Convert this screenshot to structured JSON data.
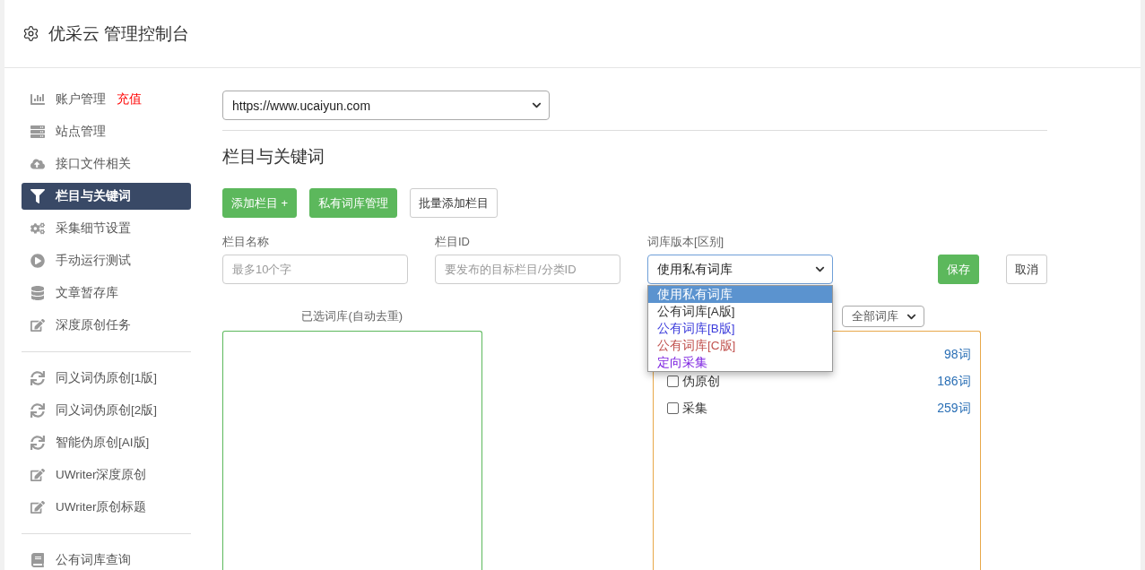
{
  "header": {
    "title": "优采云 管理控制台"
  },
  "sidebar": {
    "groups": [
      {
        "items": [
          {
            "kind": "chart",
            "label": "账户管理",
            "badge": "充值",
            "selected": false
          },
          {
            "kind": "server",
            "label": "站点管理",
            "selected": false
          },
          {
            "kind": "cloud",
            "label": "接口文件相关",
            "selected": false
          },
          {
            "kind": "filter",
            "label": "栏目与关键词",
            "selected": true
          },
          {
            "kind": "cogs",
            "label": "采集细节设置",
            "selected": false
          },
          {
            "kind": "play",
            "label": "手动运行测试",
            "selected": false
          },
          {
            "kind": "database",
            "label": "文章暂存库",
            "selected": false
          },
          {
            "kind": "edit",
            "label": "深度原创任务",
            "selected": false
          }
        ]
      },
      {
        "items": [
          {
            "kind": "sync",
            "label": "同义词伪原创[1版]",
            "selected": false
          },
          {
            "kind": "sync",
            "label": "同义词伪原创[2版]",
            "selected": false
          },
          {
            "kind": "sync",
            "label": "智能伪原创[AI版]",
            "selected": false
          },
          {
            "kind": "edit",
            "label": "UWriter深度原创",
            "selected": false
          },
          {
            "kind": "edit",
            "label": "UWriter原创标题",
            "selected": false
          }
        ]
      },
      {
        "items": [
          {
            "kind": "book",
            "label": "公有词库查询",
            "selected": false
          }
        ]
      }
    ]
  },
  "site_select": {
    "value": "https://www.ucaiyun.com"
  },
  "section_title": "栏目与关键词",
  "actions": [
    {
      "label": "添加栏目 +",
      "kind": "primary"
    },
    {
      "label": "私有词库管理",
      "kind": "primary"
    },
    {
      "label": "批量添加栏目",
      "kind": "default"
    }
  ],
  "form": {
    "name_field": {
      "label": "栏目名称",
      "placeholder": "最多10个字"
    },
    "id_field": {
      "label": "栏目ID",
      "placeholder": "要发布的目标栏目/分类ID"
    },
    "version_select": {
      "label": "词库版本[区别]",
      "value": "使用私有词库",
      "expanded": true,
      "options": [
        {
          "label": "使用私有词库",
          "selected": true
        },
        {
          "label": "公有词库[A版]",
          "selected": false,
          "color": "#333333"
        },
        {
          "label": "公有词库[B版]",
          "selected": false,
          "color": "#3b3bdb"
        },
        {
          "label": "公有词库[C版]",
          "selected": false,
          "color": "#c0504d"
        },
        {
          "label": "定向采集",
          "selected": false,
          "color": "#7b1fe0"
        }
      ]
    },
    "save": "保存",
    "cancel": "取消"
  },
  "selected_library": {
    "title": "已选词库(自动去重)"
  },
  "library_filter": {
    "value": "全部词库"
  },
  "libraries": [
    {
      "count": "98词"
    },
    {
      "name": "伪原创",
      "count": "186词",
      "checked": false
    },
    {
      "name": "采集",
      "count": "259词",
      "checked": false
    }
  ]
}
